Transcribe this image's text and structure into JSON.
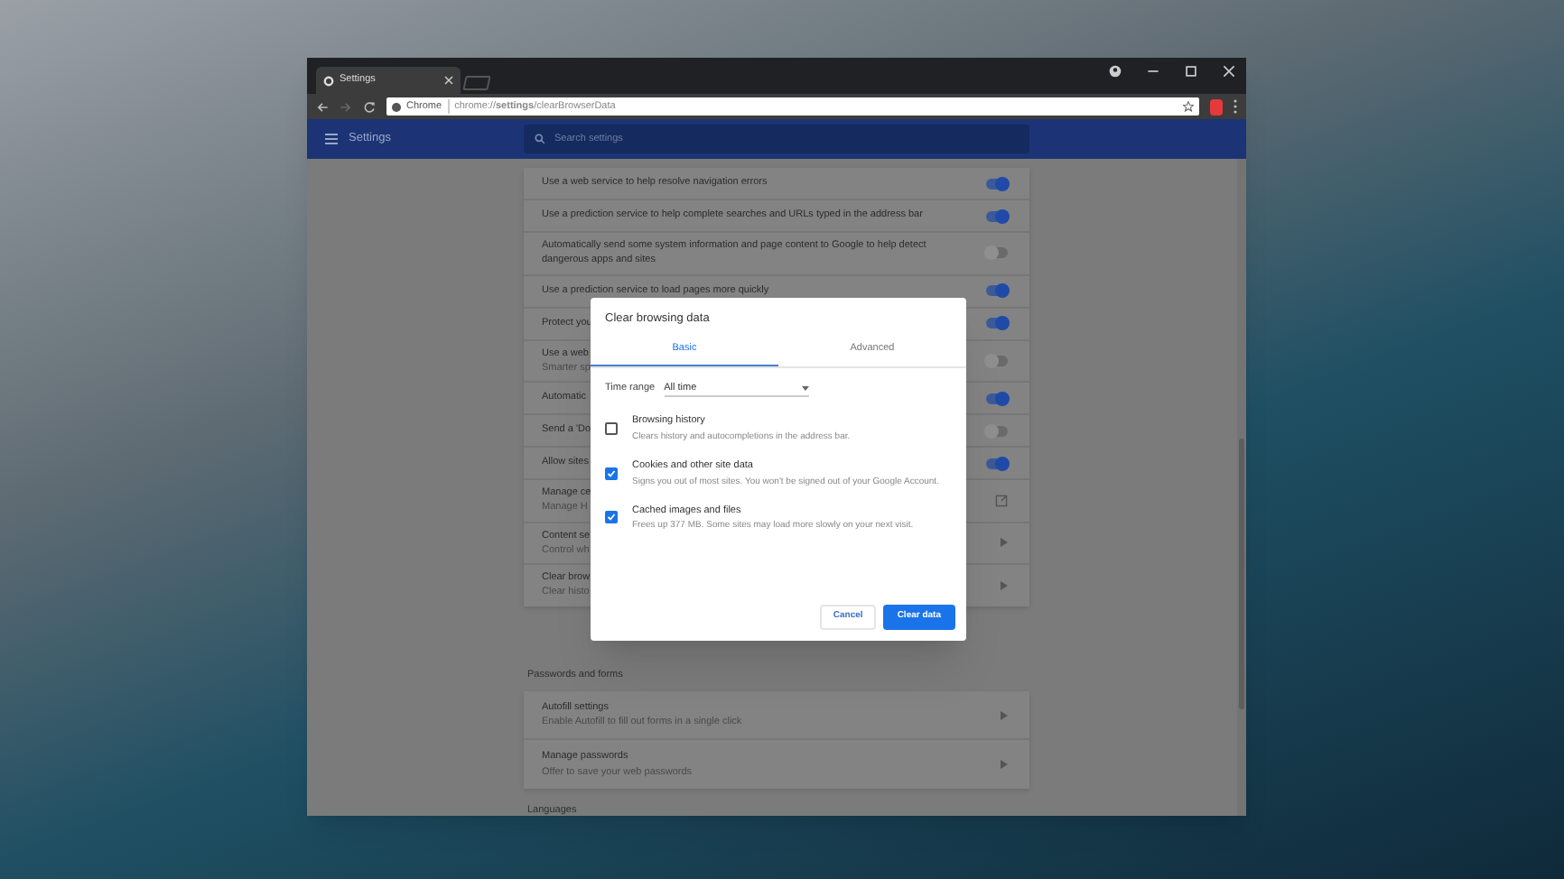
{
  "window": {
    "tab_title": "Settings",
    "site_chip": "Chrome",
    "url": "chrome://**settings**/clearBrowserData"
  },
  "header": {
    "title": "Settings",
    "search_placeholder": "Search settings"
  },
  "privacy_rows": [
    {
      "kind": "toggle",
      "title": "Use a web service to help resolve navigation errors",
      "on": true
    },
    {
      "kind": "toggle",
      "title": "Use a prediction service to help complete searches and URLs typed in the address bar",
      "on": true
    },
    {
      "kind": "toggle",
      "title": "Automatically send some system information and page content to Google to help detect dangerous apps and sites",
      "on": false
    },
    {
      "kind": "toggle",
      "title": "Use a prediction service to load pages more quickly",
      "on": true
    },
    {
      "kind": "toggle",
      "title": "Protect you",
      "on": true
    },
    {
      "kind": "toggle",
      "title": "Use a web",
      "subtitle": "Smarter sp",
      "on": false
    },
    {
      "kind": "toggle",
      "title": "Automatic",
      "on": true
    },
    {
      "kind": "toggle",
      "title": "Send a 'Do",
      "on": false
    },
    {
      "kind": "toggle",
      "title": "Allow sites",
      "on": true
    },
    {
      "kind": "link",
      "title": "Manage ce",
      "subtitle": "Manage H"
    },
    {
      "kind": "arrow",
      "title": "Content se",
      "subtitle": "Control wh"
    },
    {
      "kind": "arrow",
      "title": "Clear brow",
      "subtitle": "Clear histo"
    }
  ],
  "passwords_section": {
    "heading": "Passwords and forms",
    "rows": [
      {
        "kind": "arrow",
        "title": "Autofill settings",
        "subtitle": "Enable Autofill to fill out forms in a single click"
      },
      {
        "kind": "arrow",
        "title": "Manage passwords",
        "subtitle": "Offer to save your web passwords"
      }
    ]
  },
  "languages_heading": "Languages",
  "dialog": {
    "title": "Clear browsing data",
    "tabs": [
      {
        "label": "Basic",
        "selected": true
      },
      {
        "label": "Advanced",
        "selected": false
      }
    ],
    "time_range": {
      "label": "Time range",
      "value": "All time"
    },
    "options": [
      {
        "title": "Browsing history",
        "description": "Clears history and autocompletions in the address bar.",
        "checked": false
      },
      {
        "title": "Cookies and other site data",
        "description": "Signs you out of most sites. You won't be signed out of your Google Account.",
        "checked": true
      },
      {
        "title": "Cached images and files",
        "description": "Frees up 377 MB. Some sites may load more slowly on your next visit.",
        "checked": true
      }
    ],
    "buttons": [
      {
        "label": "Cancel",
        "kind": "secondary"
      },
      {
        "label": "Clear data",
        "kind": "primary"
      }
    ]
  }
}
